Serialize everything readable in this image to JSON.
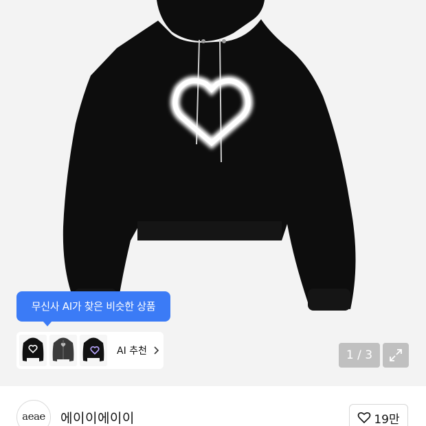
{
  "gallery": {
    "ai_tooltip": "무신사 AI가 찾은 비슷한 상품",
    "ai_recommend_label": "AI 추천",
    "counter": "1 / 3",
    "thumbnails": [
      "hoodie-heart-black-icon",
      "zip-hoodie-heart-icon",
      "hoodie-purple-heart-icon"
    ]
  },
  "brand": {
    "logo_text": "aeae",
    "name": "에이이에이이"
  },
  "like": {
    "count": "19만"
  },
  "colors": {
    "accent_blue": "#3b7bf6",
    "product_black": "#0d0d0d"
  }
}
